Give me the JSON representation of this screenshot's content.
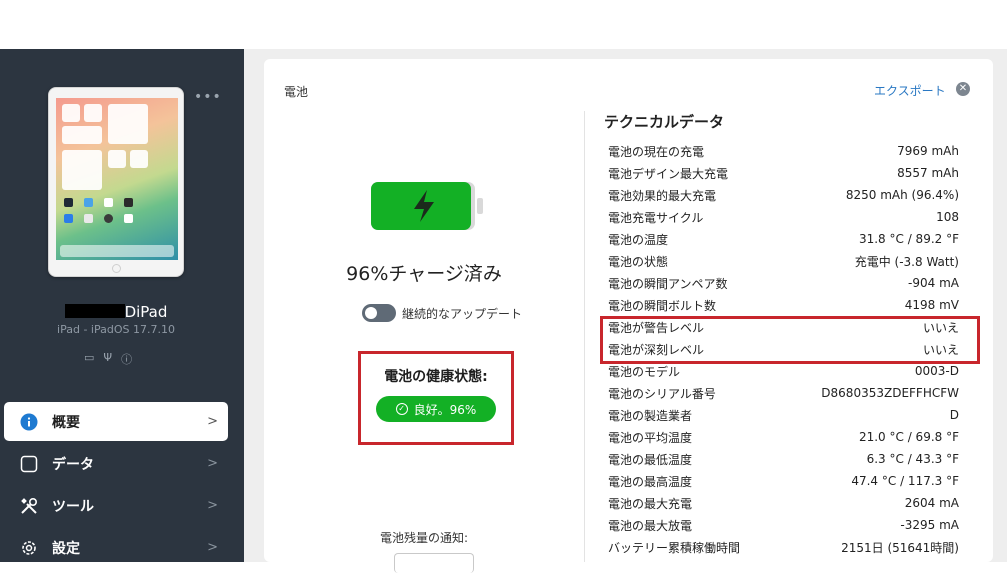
{
  "sidebar": {
    "device_name": "DiPad",
    "device_subtitle": "iPad - iPadOS 17.7.10",
    "nav": [
      {
        "label": "概要",
        "icon": "info-icon"
      },
      {
        "label": "データ",
        "icon": "square-icon"
      },
      {
        "label": "ツール",
        "icon": "tools-icon"
      },
      {
        "label": "設定",
        "icon": "gear-icon"
      }
    ]
  },
  "panel": {
    "title": "電池",
    "export_label": "エクスポート",
    "charge_status": "96%チャージ済み",
    "continuous_update_label": "継続的なアップデート",
    "health_title": "電池の健康状態:",
    "health_badge": "良好。96%",
    "notify_label": "電池残量の通知:"
  },
  "tech": {
    "title": "テクニカルデータ",
    "rows": [
      {
        "label": "電池の現在の充電",
        "value": "7969 mAh"
      },
      {
        "label": "電池デザイン最大充電",
        "value": "8557 mAh"
      },
      {
        "label": "電池効果的最大充電",
        "value": "8250 mAh (96.4%)"
      },
      {
        "label": "電池充電サイクル",
        "value": "108"
      },
      {
        "label": "電池の温度",
        "value": "31.8 °C / 89.2 °F"
      },
      {
        "label": "電池の状態",
        "value": "充電中 (-3.8 Watt)"
      },
      {
        "label": "電池の瞬間アンペア数",
        "value": "-904 mA"
      },
      {
        "label": "電池の瞬間ボルト数",
        "value": "4198 mV"
      },
      {
        "label": "電池が警告レベル",
        "value": "いいえ"
      },
      {
        "label": "電池が深刻レベル",
        "value": "いいえ"
      },
      {
        "label": "電池のモデル",
        "value": "0003-D"
      },
      {
        "label": "電池のシリアル番号",
        "value": "D8680353ZDEFFHCFW"
      },
      {
        "label": "電池の製造業者",
        "value": "D"
      },
      {
        "label": "電池の平均温度",
        "value": "21.0 °C / 69.8 °F"
      },
      {
        "label": "電池の最低温度",
        "value": "6.3 °C / 43.3 °F"
      },
      {
        "label": "電池の最高温度",
        "value": "47.4 °C / 117.3 °F"
      },
      {
        "label": "電池の最大充電",
        "value": "2604 mA"
      },
      {
        "label": "電池の最大放電",
        "value": "-3295 mA"
      },
      {
        "label": "バッテリー累積稼働時間",
        "value": "2151日 (51641時間)"
      }
    ]
  },
  "colors": {
    "sidebar": "#2c3540",
    "accent": "#2a78c3",
    "battery_green": "#13b025",
    "highlight_red": "#c8262c"
  }
}
